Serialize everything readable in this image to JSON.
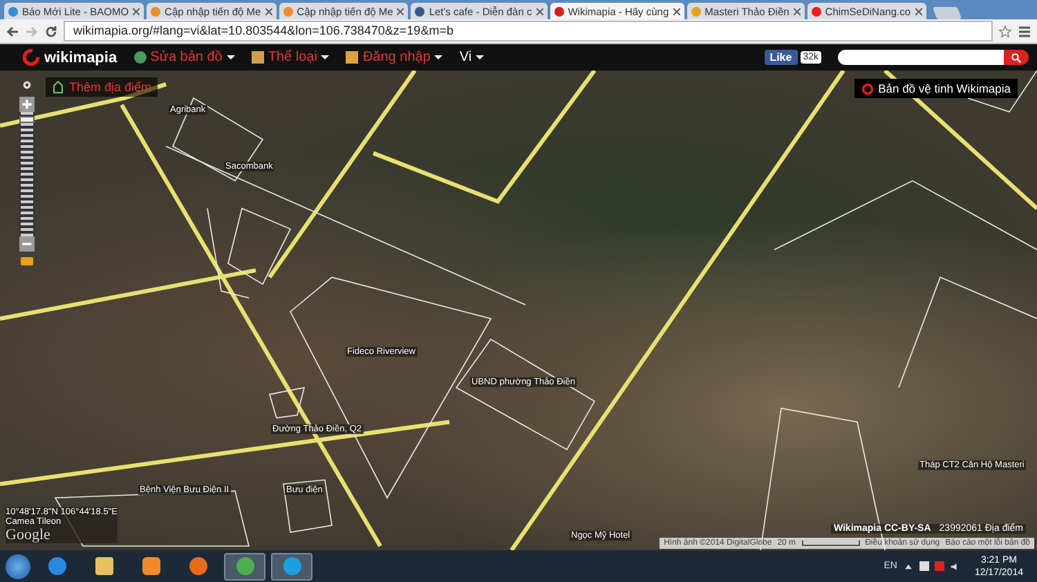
{
  "browser": {
    "tabs": [
      {
        "title": "Báo Mới Lite - BAOMO",
        "kind": "globe",
        "selected": false
      },
      {
        "title": "Cập nhập tiến độ Me",
        "kind": "orange",
        "selected": false
      },
      {
        "title": "Cập nhập tiến độ Me",
        "kind": "orange",
        "selected": false
      },
      {
        "title": "Let's cafe - Diễn đàn c",
        "kind": "doc",
        "selected": false
      },
      {
        "title": "Wikimapia - Hãy cùng",
        "kind": "wiki",
        "selected": true
      },
      {
        "title": "Masteri Thảo Điền",
        "kind": "bookmark",
        "selected": false
      },
      {
        "title": "ChimSeDiNang.co",
        "kind": "video",
        "selected": false
      }
    ],
    "address": "wikimapia.org/#lang=vi&lat=10.803544&lon=106.738470&z=19&m=b"
  },
  "site": {
    "logo": "wikimapia",
    "menus": [
      {
        "label": "Sửa bản đồ",
        "kind": "globe"
      },
      {
        "label": "Thể loại",
        "kind": "list"
      },
      {
        "label": "Đăng nhập",
        "kind": "login"
      },
      {
        "label": "Vi",
        "kind": "none"
      }
    ],
    "like": "Like",
    "like_count": "32k"
  },
  "map": {
    "zoom": {
      "level": 0.97
    },
    "add_place": "Thêm địa điểm",
    "satellite": "Bản đồ vệ tinh Wikimapia",
    "labels": [
      {
        "text": "Agribank"
      },
      {
        "text": "Sacombank"
      },
      {
        "text": "Fideco Riverview"
      },
      {
        "text": "UBND phường Thảo Điền"
      },
      {
        "text": "Đường Thảo Điền,  Q2"
      },
      {
        "text": "Bệnh Viện Bưu Điện II"
      },
      {
        "text": "Bưu điện"
      },
      {
        "text": "Ngọc Mỹ Hotel"
      },
      {
        "text": "Tháp CT2 Căn Hộ Masteri"
      }
    ],
    "coords": "10°48'17.8\"N 106°44'18.5\"E",
    "coords_sub": "Camea Tileon",
    "google": "Google",
    "license": "Wikimapia CC-BY-SA",
    "count": "23992061 Địa điểm",
    "footer": [
      "Hình ảnh ©2014 DigitalGlobe",
      "20 m",
      "Điều khoản sử dụng",
      "Báo cáo một lỗi bản đồ"
    ]
  },
  "taskbar": {
    "apps": [
      {
        "kind": "ie",
        "selected": false
      },
      {
        "kind": "folder",
        "selected": false
      },
      {
        "kind": "media",
        "selected": false
      },
      {
        "kind": "firefox",
        "selected": false
      },
      {
        "kind": "chrome",
        "selected": true
      },
      {
        "kind": "skype",
        "selected": true
      }
    ],
    "lang": "EN",
    "time": "3:21 PM",
    "date": "12/17/2014"
  }
}
